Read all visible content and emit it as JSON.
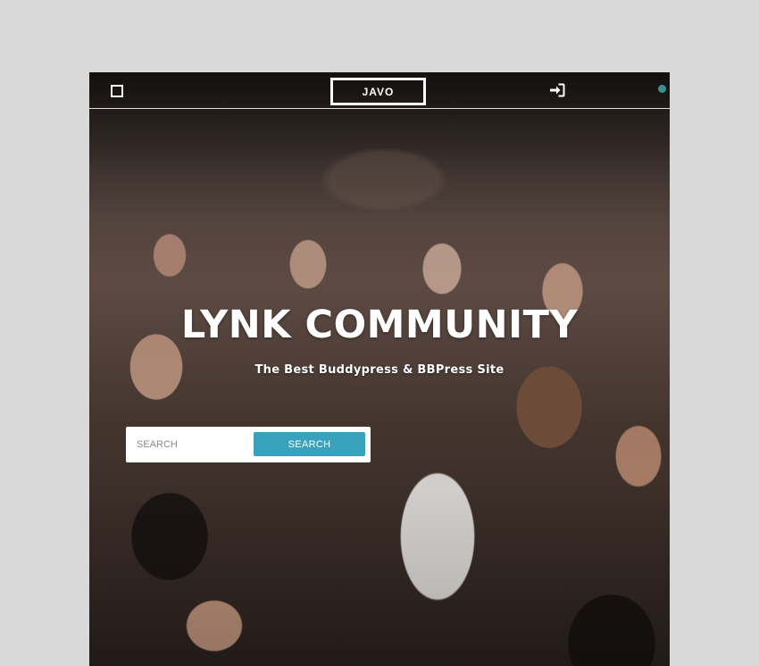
{
  "header": {
    "logo_text": "JAVO",
    "menu_icon": "menu-square-icon",
    "login_icon": "sign-in-icon",
    "accent_dot_color": "#3d8f96"
  },
  "hero": {
    "title": "LYNK COMMUNITY",
    "subtitle": "The Best Buddypress & BBPress Site"
  },
  "search": {
    "placeholder": "SEARCH",
    "button_label": "SEARCH",
    "button_color": "#39a3bd"
  }
}
